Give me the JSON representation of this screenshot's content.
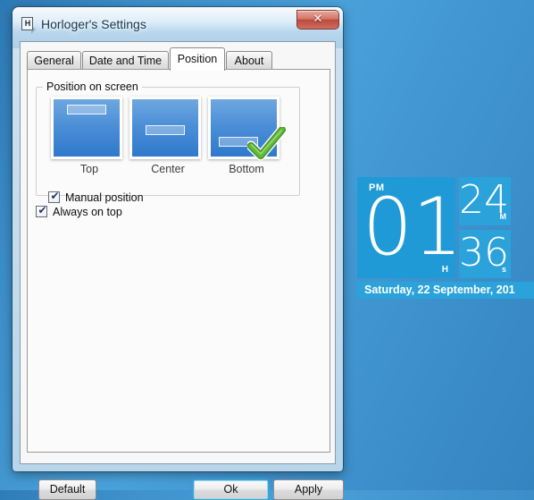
{
  "window": {
    "title": "Horloger's Settings",
    "icon_name": "document-h-icon",
    "close_label": "✕"
  },
  "tabs": [
    {
      "id": "general",
      "label": "General",
      "active": false
    },
    {
      "id": "datetime",
      "label": "Date and Time",
      "active": false
    },
    {
      "id": "position",
      "label": "Position",
      "active": true
    },
    {
      "id": "about",
      "label": "About",
      "active": false
    }
  ],
  "position_group": {
    "legend": "Position on screen",
    "options": [
      {
        "id": "top",
        "caption": "Top",
        "selected": false
      },
      {
        "id": "center",
        "caption": "Center",
        "selected": false
      },
      {
        "id": "bottom",
        "caption": "Bottom",
        "selected": true
      }
    ],
    "manual_position": {
      "label": "Manual position",
      "checked": true,
      "mark": "✔"
    }
  },
  "always_on_top": {
    "label": "Always on top",
    "checked": true,
    "mark": "✔"
  },
  "buttons": {
    "default_label": "Default",
    "ok_label": "Ok",
    "apply_label": "Apply"
  },
  "clock_widget": {
    "ampm": "PM",
    "hour": "01",
    "hour_unit": "H",
    "minute": "24",
    "minute_unit": "M",
    "second": "36",
    "second_unit": "s",
    "date": "Saturday, 22 September, 201"
  },
  "colors": {
    "desktop_blue": "#3d8fc9",
    "tile_blue": "#1f9ad6",
    "tile_blue_light": "#2ba2da",
    "accent_green": "#5aa832",
    "close_red": "#bb4a3c"
  }
}
